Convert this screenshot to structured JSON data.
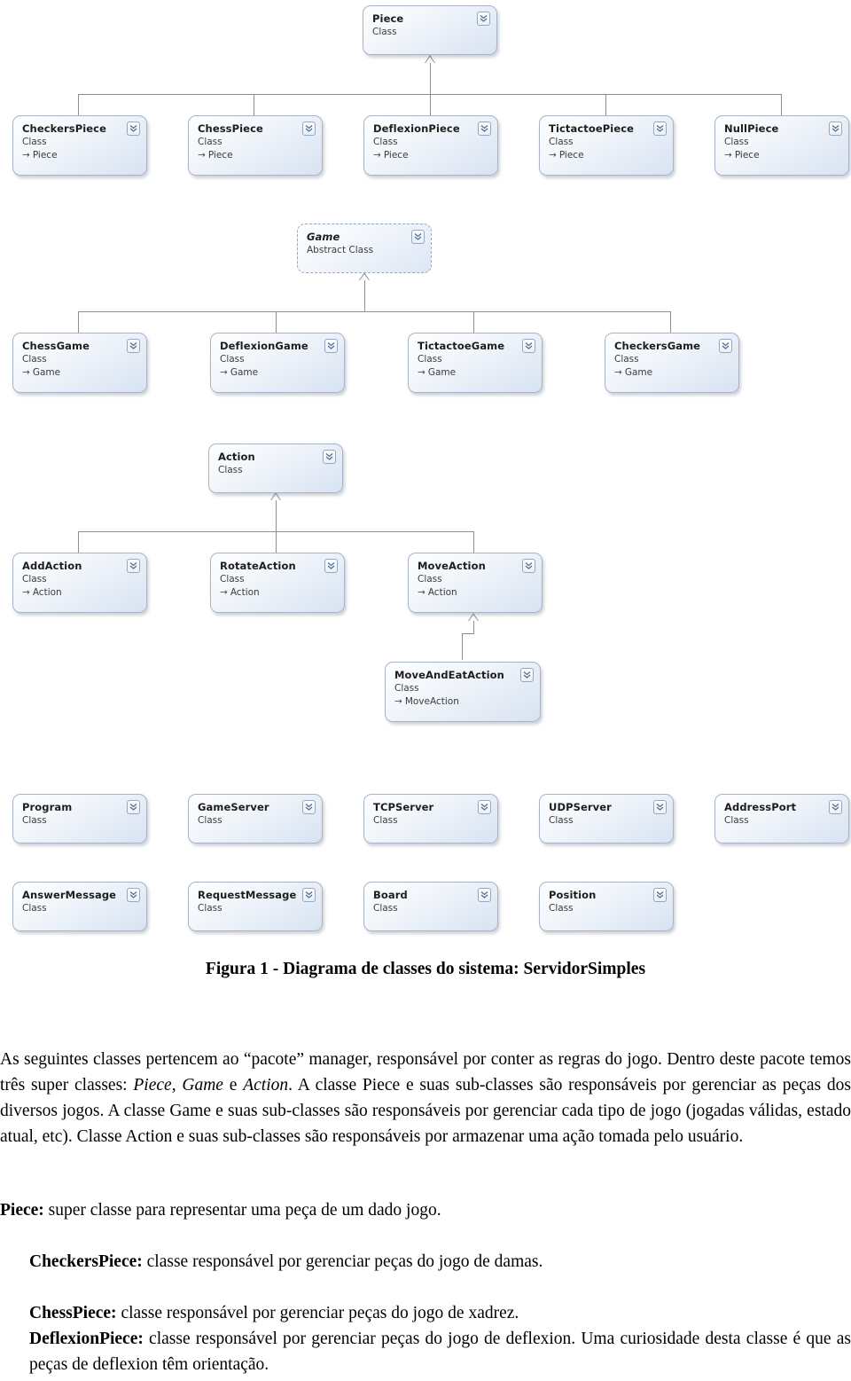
{
  "document": {
    "figure_caption": "Figura 1 - Diagrama de classes do sistema: ServidorSimples",
    "icons": {
      "collapse": "chevron-double-down-icon",
      "inheritance_arrow": "→"
    },
    "colors": {
      "box_border": "#a7b4c6",
      "box_fill_light": "#fdfeff",
      "box_fill_dark": "#d8e3f2",
      "connector": "#8e8e8e",
      "text": "#000000"
    }
  },
  "diagram": {
    "title": "ServidorSimples class diagram",
    "groups": [
      {
        "name": "piece-hierarchy",
        "parent": {
          "name": "Piece",
          "stereotype": "Class",
          "base": ""
        },
        "children": [
          {
            "name": "CheckersPiece",
            "stereotype": "Class",
            "base": "Piece"
          },
          {
            "name": "ChessPiece",
            "stereotype": "Class",
            "base": "Piece"
          },
          {
            "name": "DeflexionPiece",
            "stereotype": "Class",
            "base": "Piece"
          },
          {
            "name": "TictactoePiece",
            "stereotype": "Class",
            "base": "Piece"
          },
          {
            "name": "NullPiece",
            "stereotype": "Class",
            "base": "Piece"
          }
        ]
      },
      {
        "name": "game-hierarchy",
        "parent": {
          "name": "Game",
          "stereotype": "Abstract Class",
          "base": ""
        },
        "children": [
          {
            "name": "ChessGame",
            "stereotype": "Class",
            "base": "Game"
          },
          {
            "name": "DeflexionGame",
            "stereotype": "Class",
            "base": "Game"
          },
          {
            "name": "TictactoeGame",
            "stereotype": "Class",
            "base": "Game"
          },
          {
            "name": "CheckersGame",
            "stereotype": "Class",
            "base": "Game"
          }
        ]
      },
      {
        "name": "action-hierarchy",
        "parent": {
          "name": "Action",
          "stereotype": "Class",
          "base": ""
        },
        "children": [
          {
            "name": "AddAction",
            "stereotype": "Class",
            "base": "Action"
          },
          {
            "name": "RotateAction",
            "stereotype": "Class",
            "base": "Action"
          },
          {
            "name": "MoveAction",
            "stereotype": "Class",
            "base": "Action"
          }
        ],
        "grandchild": {
          "name": "MoveAndEatAction",
          "stereotype": "Class",
          "base": "MoveAction"
        }
      },
      {
        "name": "infrastructure-classes-row1",
        "children": [
          {
            "name": "Program",
            "stereotype": "Class",
            "base": ""
          },
          {
            "name": "GameServer",
            "stereotype": "Class",
            "base": ""
          },
          {
            "name": "TCPServer",
            "stereotype": "Class",
            "base": ""
          },
          {
            "name": "UDPServer",
            "stereotype": "Class",
            "base": ""
          },
          {
            "name": "AddressPort",
            "stereotype": "Class",
            "base": ""
          }
        ]
      },
      {
        "name": "infrastructure-classes-row2",
        "children": [
          {
            "name": "AnswerMessage",
            "stereotype": "Class",
            "base": ""
          },
          {
            "name": "RequestMessage",
            "stereotype": "Class",
            "base": ""
          },
          {
            "name": "Board",
            "stereotype": "Class",
            "base": ""
          },
          {
            "name": "Position",
            "stereotype": "Class",
            "base": ""
          }
        ]
      }
    ]
  },
  "body": {
    "intro_p1_a": "As seguintes classes pertencem ao “pacote” manager, responsável por conter as regras do jogo. Dentro deste pacote temos três super classes: ",
    "intro_i1": "Piece",
    "intro_sep1": ", ",
    "intro_i2": "Game",
    "intro_sep2": " e ",
    "intro_i3": "Action",
    "intro_p1_b": ". A classe Piece e suas sub-classes são responsáveis por gerenciar as peças dos diversos jogos. A classe Game e suas sub-classes são responsáveis por gerenciar cada tipo de jogo (jogadas válidas, estado atual, etc). Classe Action e suas sub-classes são responsáveis por armazenar uma ação tomada pelo usuário.",
    "entries": [
      {
        "term": "Piece:",
        "desc": " super classe para representar uma peça de um dado jogo."
      },
      {
        "term": "CheckersPiece:",
        "desc": " classe responsável por gerenciar peças do jogo de damas."
      },
      {
        "term": "ChessPiece:",
        "desc": " classe responsável por gerenciar peças do jogo de xadrez."
      },
      {
        "term": "DeflexionPiece:",
        "desc": " classe responsável por gerenciar peças do jogo de deflexion. Uma curiosidade desta classe é que as peças de deflexion têm orientação."
      }
    ]
  }
}
